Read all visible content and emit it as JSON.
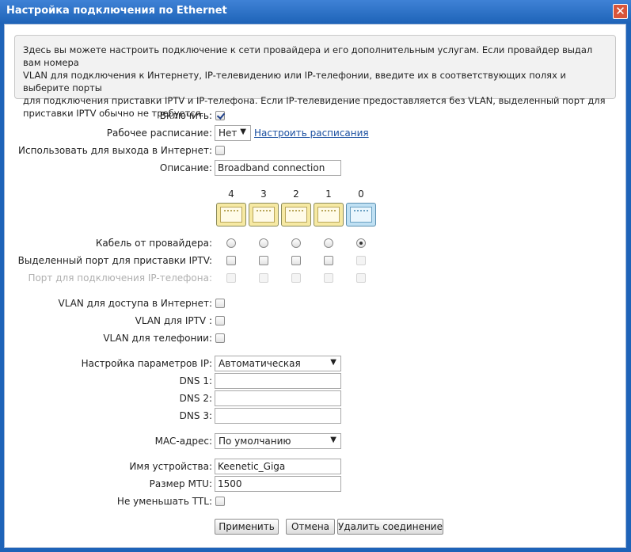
{
  "window": {
    "title": "Настройка подключения по Ethernet",
    "close_label": "✕"
  },
  "info_lines": [
    "Здесь вы можете настроить подключение к сети провайдера и его дополнительным услугам. Если провайдер выдал вам номера",
    "VLAN для подключения к Интернету, IP-телевидению или IP-телефонии, введите их в соответствующих полях и выберите порты",
    "для подключения приставки IPTV и IP-телефона. Если IP-телевидение предоставляется без VLAN, выделенный порт для",
    "приставки IPTV обычно не требуется."
  ],
  "form": {
    "enable": {
      "label": "Включить:",
      "checked": true
    },
    "schedule": {
      "label": "Рабочее расписание:",
      "value": "Нет",
      "link": "Настроить расписания"
    },
    "use_internet": {
      "label": "Использовать для выхода в Интернет:",
      "checked": false
    },
    "description": {
      "label": "Описание:",
      "value": "Broadband connection"
    },
    "ports": [
      "4",
      "3",
      "2",
      "1",
      "0"
    ],
    "wan_port_index": 4,
    "cable_label": "Кабель от провайдера:",
    "iptv_port_label": "Выделенный порт для приставки IPTV:",
    "phone_port_label": "Порт для подключения IP-телефона:",
    "vlan_internet_label": "VLAN для доступа в Интернет:",
    "vlan_iptv_label": "VLAN для IPTV :",
    "vlan_phone_label": "VLAN для телефонии:",
    "ip_settings": {
      "label": "Настройка параметров IP:",
      "value": "Автоматическая"
    },
    "dns1_label": "DNS 1:",
    "dns2_label": "DNS 2:",
    "dns3_label": "DNS 3:",
    "mac": {
      "label": "MAC-адрес:",
      "value": "По умолчанию"
    },
    "device_name": {
      "label": "Имя устройства:",
      "value": "Keenetic_Giga"
    },
    "mtu": {
      "label": "Размер MTU:",
      "value": "1500"
    },
    "ttl": {
      "label": "Не уменьшать TTL:",
      "checked": false
    }
  },
  "buttons": {
    "apply": "Применить",
    "cancel": "Отмена",
    "delete": "Удалить соединение"
  },
  "icons": {
    "dropdown_arrow": "▼"
  }
}
